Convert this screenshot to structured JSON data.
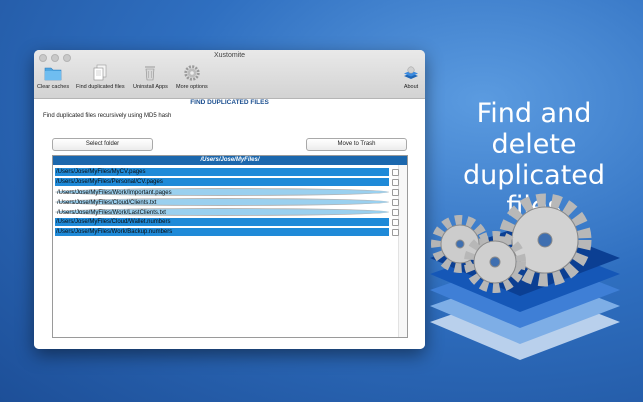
{
  "window": {
    "title": "Xustomite"
  },
  "toolbar": {
    "items": [
      {
        "label": "Clear caches",
        "icon": "folder-icon"
      },
      {
        "label": "Find duplicated files",
        "icon": "documents-icon"
      },
      {
        "label": "Uninstall Apps",
        "icon": "trash-icon"
      },
      {
        "label": "More options",
        "icon": "gear-icon"
      },
      {
        "label": "About",
        "icon": "app-icon"
      }
    ]
  },
  "main": {
    "heading": "FIND DUPLICATED FILES",
    "description": "Find duplicated files recursively using MD5 hash",
    "select_folder_label": "Select folder",
    "move_to_trash_label": "Move to Trash"
  },
  "results": {
    "folder": "/Users/Jose/MyFiles/",
    "rows": [
      {
        "path": "/Users/Jose/MyFiles/MyCV.pages",
        "checked": false,
        "shade": "dark"
      },
      {
        "path": "/Users/Jose/MyFiles/Personal/CV.pages",
        "checked": false,
        "shade": "dark"
      },
      {
        "path": "/Users/Jose/MyFiles/Work/Important.pages",
        "checked": false,
        "shade": "light"
      },
      {
        "path": "/Users/Jose/MyFiles/Cloud/Clients.txt",
        "checked": false,
        "shade": "light"
      },
      {
        "path": "/Users/Jose/MyFiles/Work/LastClients.txt",
        "checked": false,
        "shade": "light"
      },
      {
        "path": "/Users/Jose/MyFiles/Cloud/Wallet.numbers",
        "checked": false,
        "shade": "dark"
      },
      {
        "path": "/Users/Jose/MyFiles/Work/Backup.numbers",
        "checked": false,
        "shade": "dark"
      }
    ]
  },
  "promo": {
    "line1": "Find and delete",
    "line2": "duplicated files"
  },
  "colors": {
    "accent": "#1b67ad",
    "row_dark": "#1f8ad8",
    "row_light": "#9ad0ef",
    "heading": "#1a4e8f"
  }
}
